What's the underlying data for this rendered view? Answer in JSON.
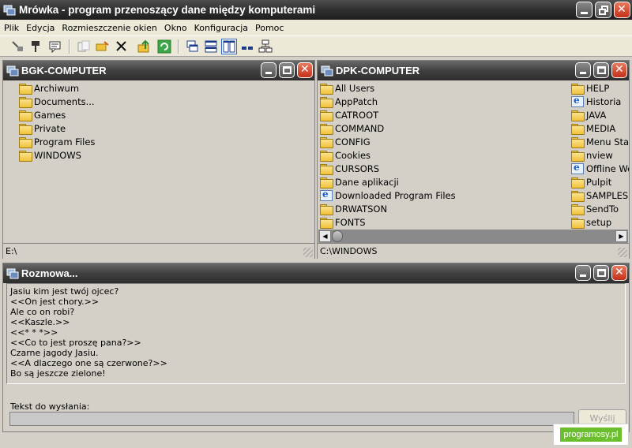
{
  "app": {
    "title": "Mrówka - program przenoszący dane między komputerami"
  },
  "menu": [
    "Plik",
    "Edycja",
    "Rozmieszczenie okien",
    "Okno",
    "Konfiguracja",
    "Pomoc"
  ],
  "left_panel": {
    "title": "BGK-COMPUTER",
    "items": [
      "Archiwum",
      "Documents...",
      "Games",
      "Private",
      "Program Files",
      "WINDOWS"
    ],
    "path": "E:\\"
  },
  "right_panel": {
    "title": "DPK-COMPUTER",
    "col1": [
      "All Users",
      "AppPatch",
      "CATROOT",
      "COMMAND",
      "CONFIG",
      "Cookies",
      "CURSORS",
      "Dane aplikacji",
      "Downloaded Program Files",
      "DRWATSON",
      "FONTS"
    ],
    "col2": [
      "HELP",
      "Historia",
      "JAVA",
      "MEDIA",
      "Menu Start",
      "nview",
      "Offline Web",
      "Pulpit",
      "SAMPLES",
      "SendTo",
      "setup"
    ],
    "path": "C:\\WINDOWS"
  },
  "chat": {
    "title": "Rozmowa...",
    "lines": [
      "Jasiu kim jest twój ojcec?",
      "<<On jest chory.>>",
      "Ale co on robi?",
      "<<Kaszle.>>",
      "<<* * *>>",
      "<<Co to jest proszę pana?>>",
      "Czarne jagody Jasiu.",
      "<<A dlaczego one są czerwone?>>",
      "Bo są jeszcze zielone!"
    ],
    "send_label": "Tekst do wysłania:",
    "send_value": "",
    "send_button": "Wyślij"
  },
  "watermark": "programosy.pl"
}
